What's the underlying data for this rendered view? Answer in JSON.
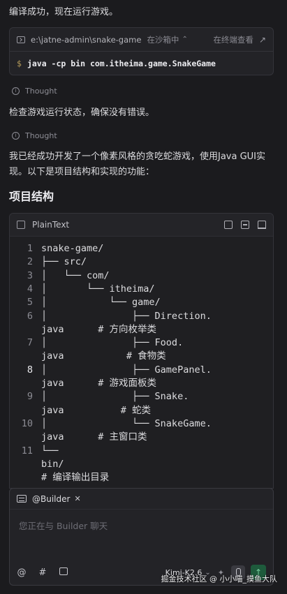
{
  "messages": {
    "compiled": "编译成功，现在运行游戏。",
    "check": "检查游戏运行状态，确保没有错误。",
    "summary": "我已经成功开发了一个像素风格的贪吃蛇游戏，使用Java GUI实现。以下是项目结构和实现的功能："
  },
  "terminal": {
    "path": "e:\\jatne-admin\\snake-game",
    "sandbox": "在沙箱中",
    "open_label": "在终端查看",
    "prompt": "$",
    "command": "java -cp bin com.itheima.game.SnakeGame"
  },
  "thought_label": "Thought",
  "section_title": "项目结构",
  "code_block": {
    "language": "PlainText",
    "rows": [
      {
        "num": "1",
        "text": "snake-game/"
      },
      {
        "num": "2",
        "text": "├── src/"
      },
      {
        "num": "3",
        "text": "│   └── com/"
      },
      {
        "num": "4",
        "text": "│       └── itheima/"
      },
      {
        "num": "5",
        "text": "│           └── game/"
      },
      {
        "num": "6",
        "text": "│               ├── Direction."
      },
      {
        "num": "",
        "text": "java      # 方向枚举类"
      },
      {
        "num": "7",
        "text": "│               ├── Food."
      },
      {
        "num": "",
        "text": "java           # 食物类"
      },
      {
        "num": "8",
        "text": "│               ├── GamePanel."
      },
      {
        "num": "",
        "text": "java      # 游戏面板类"
      },
      {
        "num": "9",
        "text": "│               ├── Snake."
      },
      {
        "num": "",
        "text": "java          # 蛇类"
      },
      {
        "num": "10",
        "text": "│               └── SnakeGame."
      },
      {
        "num": "",
        "text": "java      # 主窗口类"
      },
      {
        "num": "11",
        "text": "└──"
      },
      {
        "num": "",
        "text": "bin/"
      },
      {
        "num": "",
        "text": "# 编译输出目录"
      }
    ],
    "active_line": "8"
  },
  "chat": {
    "agent": "@Builder",
    "placeholder": "您正在与 Builder 聊天",
    "model": "Kimi-K2.6",
    "tools": [
      "@",
      "#"
    ]
  },
  "watermark": "掘金技术社区 @ 小小喵_摸鱼大队"
}
